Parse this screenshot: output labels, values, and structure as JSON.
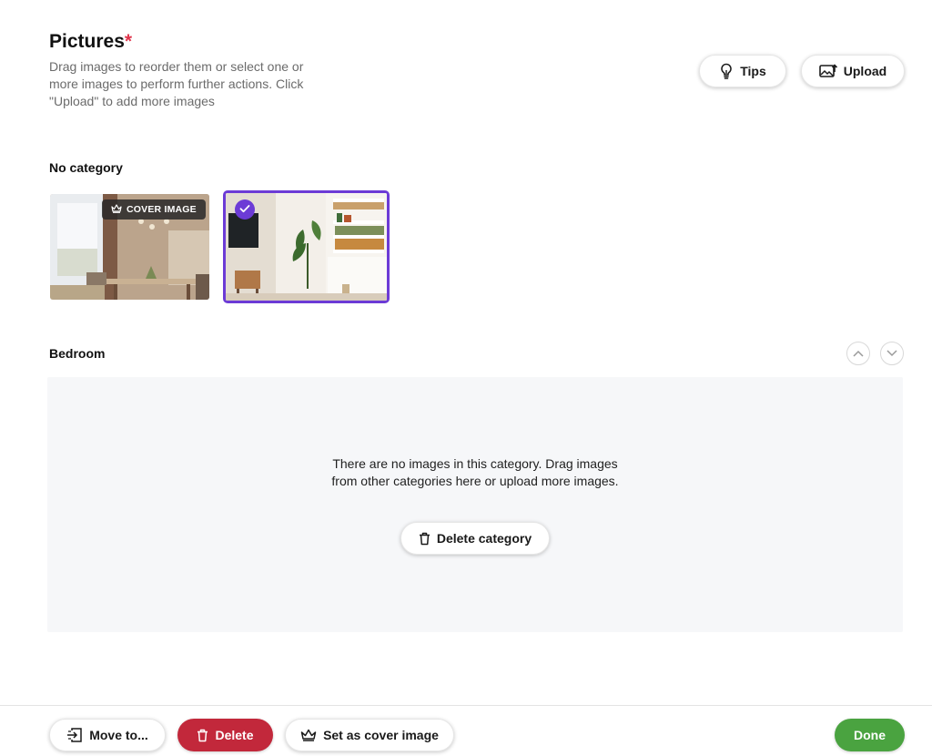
{
  "header": {
    "title": "Pictures",
    "required_mark": "*",
    "description": "Drag images to reorder them or select one or more images to perform further actions. Click \"Upload\" to add more images",
    "tips_label": "Tips",
    "upload_label": "Upload"
  },
  "categories": [
    {
      "name": "No category",
      "images": [
        {
          "badge": "COVER IMAGE",
          "selected": false
        },
        {
          "badge": "",
          "selected": true
        }
      ]
    },
    {
      "name": "Bedroom",
      "empty_message_line1": "There are no images in this category. Drag images",
      "empty_message_line2": "from other categories here or upload more images.",
      "delete_category_label": "Delete category"
    }
  ],
  "footer": {
    "move_label": "Move to...",
    "delete_label": "Delete",
    "cover_label": "Set as cover image",
    "done_label": "Done"
  },
  "colors": {
    "accent": "#6c3bd6",
    "danger": "#c2283b",
    "success": "#4aa340",
    "required": "#e0344b"
  },
  "icons": [
    "bulb-icon",
    "upload-image-icon",
    "crown-icon",
    "check-icon",
    "chevron-up-icon",
    "chevron-down-icon",
    "trash-icon",
    "move-icon"
  ]
}
